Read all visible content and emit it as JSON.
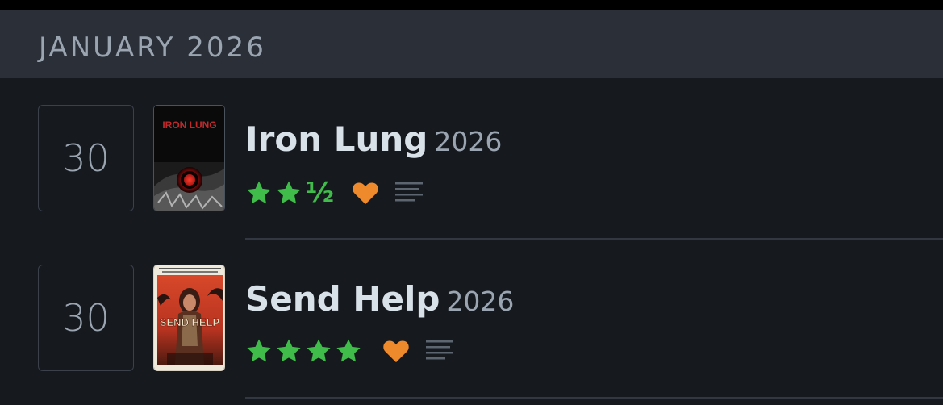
{
  "month_header": "JANUARY 2026",
  "colors": {
    "star_green": "#40bc4b",
    "heart_orange": "#ee8a2c",
    "text_light": "#d8e0e8",
    "text_muted": "#9aa5b1",
    "header_bg": "#2b3038",
    "page_bg": "#16191e"
  },
  "entries": [
    {
      "day": "30",
      "title": "Iron Lung",
      "year": "2026",
      "rating_stars": 2.5,
      "rating_half_glyph": "½",
      "liked": true,
      "has_review": true,
      "poster_text": "IRON LUNG"
    },
    {
      "day": "30",
      "title": "Send Help",
      "year": "2026",
      "rating_stars": 4,
      "liked": true,
      "has_review": true,
      "poster_text": "SEND HELP"
    }
  ],
  "icons": {
    "star": "star-icon",
    "heart": "heart-icon",
    "review": "review-lines-icon"
  }
}
